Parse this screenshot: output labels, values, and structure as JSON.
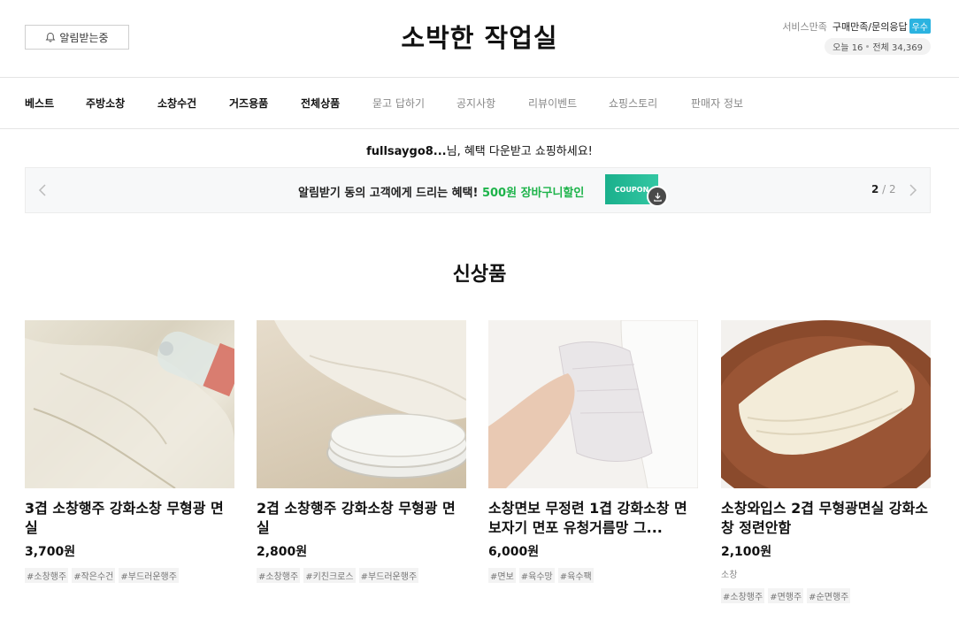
{
  "header": {
    "alarm_label": "알림받는중",
    "store_title": "소박한 작업실",
    "service_label": "서비스만족",
    "service_value": "구매만족/문의응답",
    "service_badge": "우수",
    "visits_today": "오늘 16",
    "visits_total": "전체 34,369"
  },
  "nav": {
    "items": [
      "베스트",
      "주방소창",
      "소창수건",
      "거즈용품",
      "전체상품",
      "묻고 답하기",
      "공지사항",
      "리뷰이벤트",
      "쇼핑스토리",
      "판매자 정보"
    ]
  },
  "welcome": {
    "user": "fullsaygo8...",
    "message": "님, 혜택 다운받고 쇼핑하세요!"
  },
  "banner": {
    "text": "알림받기 동의 고객에게 드리는 혜택!",
    "highlight": "500원 장바구니할인",
    "coupon_label": "COUPON",
    "page_current": "2",
    "page_separator": " / ",
    "page_total": "2"
  },
  "section": {
    "title": "신상품"
  },
  "products": [
    {
      "name": "3겹 소창행주 강화소창 무형광 면실",
      "price": "3,700원",
      "category": "",
      "tags": [
        "#소창행주",
        "#작은수건",
        "#부드러운행주"
      ]
    },
    {
      "name": "2겹 소창행주 강화소창 무형광 면실",
      "price": "2,800원",
      "category": "",
      "tags": [
        "#소창행주",
        "#키친크로스",
        "#부드러운행주"
      ]
    },
    {
      "name": "소창면보 무정련 1겹 강화소창 면보자기 면포 유청거름망 그...",
      "price": "6,000원",
      "category": "",
      "tags": [
        "#면보",
        "#육수망",
        "#육수팩"
      ]
    },
    {
      "name": "소창와입스 2겹 무형광면실 강화소창 정련안함",
      "price": "2,100원",
      "category": "소창",
      "tags": [
        "#소창행주",
        "#면행주",
        "#순면행주"
      ]
    }
  ],
  "colors": {
    "accent_green": "#1db34a",
    "coupon_teal": "#1ab08c",
    "badge_blue": "#2bb3e0"
  }
}
